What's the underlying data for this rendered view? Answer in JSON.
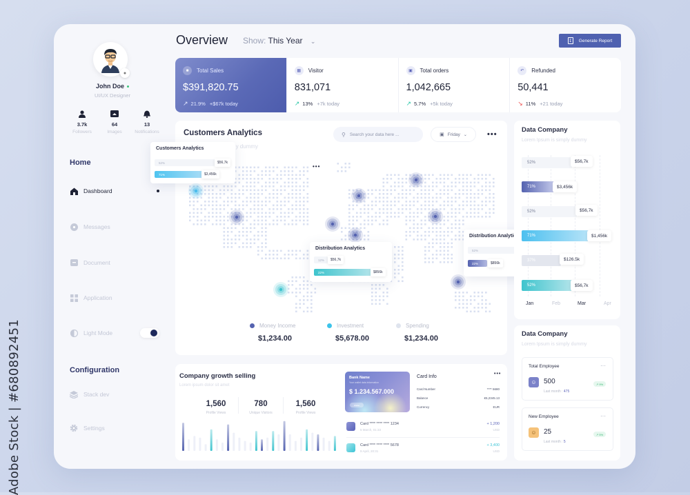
{
  "watermark": "Adobe Stock | #680892451",
  "sidebar": {
    "user": {
      "name": "John Doe",
      "role": "UI/UX Designer",
      "status": "online"
    },
    "stats": [
      {
        "icon": "user-icon",
        "value": "3.7k",
        "label": "Followers"
      },
      {
        "icon": "image-icon",
        "value": "64",
        "label": "Images"
      },
      {
        "icon": "bell-icon",
        "value": "13",
        "label": "Notifications"
      }
    ],
    "home_heading": "Home",
    "items": [
      {
        "icon": "home-icon",
        "label": "Dashboard",
        "active": true
      },
      {
        "icon": "message-icon",
        "label": "Messages"
      },
      {
        "icon": "document-icon",
        "label": "Document"
      },
      {
        "icon": "grid-icon",
        "label": "Application"
      },
      {
        "icon": "contrast-icon",
        "label": "Light Mode",
        "toggle": true
      }
    ],
    "config_heading": "Configuration",
    "config_items": [
      {
        "icon": "layers-icon",
        "label": "Stack dev"
      },
      {
        "icon": "gear-icon",
        "label": "Settings"
      }
    ]
  },
  "header": {
    "title": "Overview",
    "show_label": "Show:",
    "show_value": "This Year",
    "generate_button": "Generate Report"
  },
  "kpis": [
    {
      "label": "Total Sales",
      "value": "$391,820.75",
      "trend": "up",
      "pct": "21.9%",
      "today": "+$67k today"
    },
    {
      "label": "Visitor",
      "value": "831,071",
      "trend": "up",
      "pct": "13%",
      "today": "+7k today"
    },
    {
      "label": "Total orders",
      "value": "1,042,665",
      "trend": "up",
      "pct": "5.7%",
      "today": "+5k today"
    },
    {
      "label": "Refunded",
      "value": "50,441",
      "trend": "down",
      "pct": "11%",
      "today": "+21 today"
    }
  ],
  "customers": {
    "title": "Customers Analytics",
    "subtitle": "Lorem Ipsum is simply dummy",
    "search_placeholder": "Search your data here ...",
    "day": "Friday",
    "legend": [
      {
        "label": "Money Income",
        "value": "$1,234.00",
        "color": "#5563b0"
      },
      {
        "label": "Investment",
        "value": "$5,678.00",
        "color": "#3dc3ea"
      },
      {
        "label": "Spending",
        "value": "$1,234.00",
        "color": "#dfe4ee"
      }
    ],
    "popover_customers": {
      "title": "Customers Analytics",
      "bars": [
        {
          "pct": "52%",
          "value": "$56,7k"
        },
        {
          "pct": "71%",
          "value": "$3,456k"
        }
      ]
    },
    "popover_dist_left": {
      "title": "Distribution Analytics",
      "bars": [
        {
          "pct": "12%",
          "value": "$56,7k"
        },
        {
          "pct": "22%",
          "value": "$856k"
        }
      ]
    },
    "popover_dist_right": {
      "title": "Distribution Analytics",
      "bars": [
        {
          "pct": "52%",
          "value": "$56,7k"
        },
        {
          "pct": "22%",
          "value": "$856k"
        }
      ]
    }
  },
  "growth": {
    "title": "Company growth selling",
    "subtitle": "Lorem ipsum dolor sit amet",
    "metrics": [
      {
        "value": "1,560",
        "label": "Profile Views"
      },
      {
        "value": "780",
        "label": "Unique Visitors"
      },
      {
        "value": "1,560",
        "label": "Profile Views"
      }
    ],
    "bars": [
      0.85,
      0.35,
      0.45,
      0.4,
      0.2,
      0.65,
      0.35,
      0.25,
      0.8,
      0.55,
      0.4,
      0.3,
      0.25,
      0.6,
      0.35,
      0.4,
      0.6,
      0.5,
      0.9,
      0.5,
      0.3,
      0.4,
      0.65,
      0.55,
      0.5,
      0.4,
      0.3,
      0.45
    ],
    "bar_colors": [
      "blue",
      "light",
      "light",
      "light",
      "light",
      "cyan",
      "light",
      "light",
      "blue",
      "light",
      "light",
      "light",
      "light",
      "cyan",
      "blue",
      "light",
      "cyan",
      "light",
      "blue",
      "light",
      "light",
      "light",
      "cyan",
      "light",
      "blue",
      "light",
      "light",
      "cyan"
    ]
  },
  "bank_card": {
    "bank_name": "Bank Name",
    "sub": "Your wallet data information",
    "amount": "$ 1.234.567.000",
    "button": "Wallet"
  },
  "card_info": {
    "title": "Card Info",
    "rows": [
      {
        "label": "Card Number",
        "value": "**** 5680"
      },
      {
        "label": "Balance",
        "value": "€5,2345.13"
      },
      {
        "label": "Currency",
        "value": "EUR"
      }
    ],
    "transactions": [
      {
        "card": "Card **** **** **** 1234",
        "date": "5 March, 01:33",
        "amount": "+ 1,200",
        "currency": "USD",
        "color": "#5a62b8"
      },
      {
        "card": "Card **** **** **** 5678",
        "date": "9 April, 20:31",
        "amount": "+ 3,400",
        "currency": "USD",
        "color": "#3cc4d6"
      }
    ]
  },
  "data_company": {
    "title": "Data Company",
    "subtitle": "Lorem Ipsum is simply dummy",
    "bars": [
      {
        "pct": "52%",
        "value": "$56,7k",
        "style": "light"
      },
      {
        "pct": "71%",
        "value": "$3,456k",
        "style": "indigo"
      },
      {
        "pct": "52%",
        "value": "$56,7k",
        "style": "light"
      },
      {
        "pct": "71%",
        "value": "$1,456k",
        "style": "sky"
      },
      {
        "pct": "37%",
        "value": "$126.5k",
        "style": "grey"
      },
      {
        "pct": "52%",
        "value": "$56,7k",
        "style": "teal"
      }
    ],
    "months": [
      "Jan",
      "Feb",
      "Mar",
      "Apr"
    ]
  },
  "data_company_2": {
    "title": "Data Company",
    "subtitle": "Lorem Ipsum is simply dummy",
    "cards": [
      {
        "title": "Total Employee",
        "value": "500",
        "last_label": "Last month :",
        "last_value": "475",
        "badge": "9%",
        "icon_color": "#7b82c9"
      },
      {
        "title": "New Employee",
        "value": "25",
        "last_label": "Last month :",
        "last_value": "5",
        "badge": "5%",
        "icon_color": "#f5c27a"
      }
    ]
  }
}
